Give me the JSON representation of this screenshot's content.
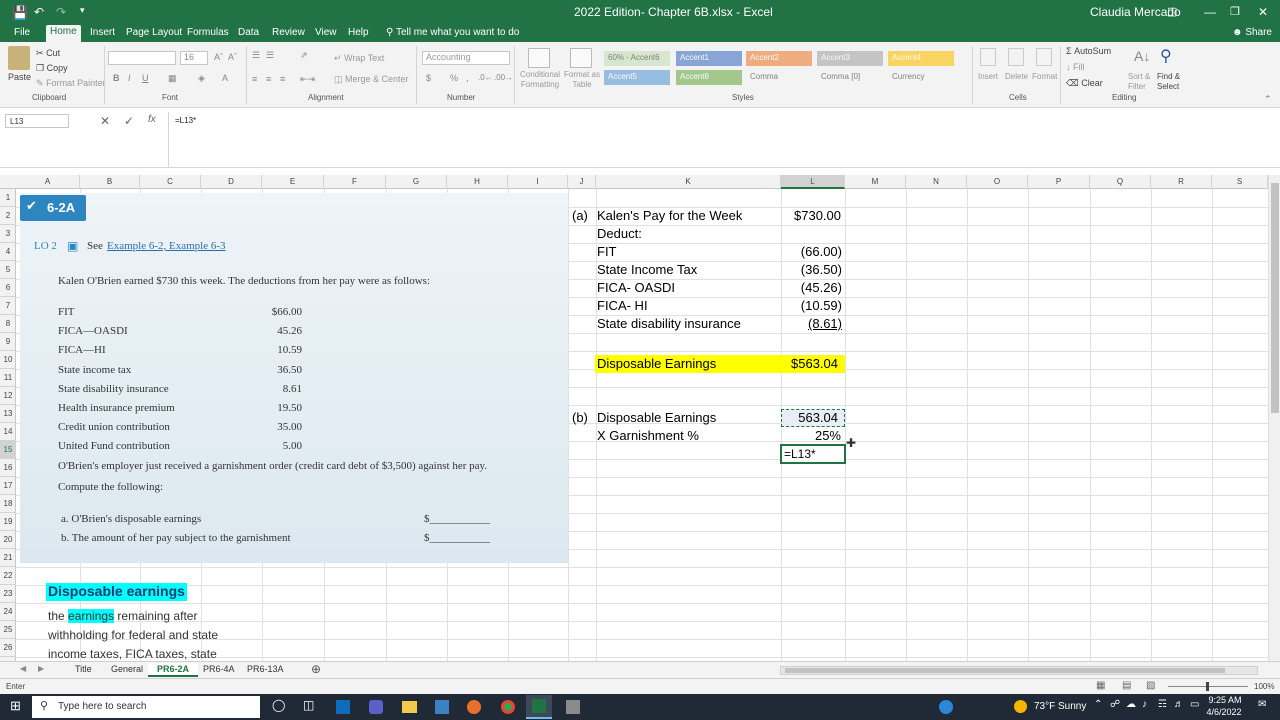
{
  "titlebar": {
    "doc_title": "2022 Edition- Chapter 6B.xlsx - Excel",
    "user": "Claudia Mercado"
  },
  "ribbon_tabs": [
    "File",
    "Home",
    "Insert",
    "Page Layout",
    "Formulas",
    "Data",
    "Review",
    "View",
    "Help"
  ],
  "tell_me": "Tell me what you want to do",
  "share_label": "Share",
  "ribbon": {
    "paste": "Paste",
    "cut": "Cut",
    "copy": "Copy",
    "format_painter": "Format Painter",
    "font_size": "16",
    "wrap_text": "Wrap Text",
    "merge_center": "Merge & Center",
    "number_format": "Accounting",
    "conditional_formatting": "Conditional Formatting",
    "format_as_table": "Format as Table",
    "insert": "Insert",
    "delete": "Delete",
    "format": "Format",
    "autosum": "AutoSum",
    "fill": "Fill",
    "clear": "Clear",
    "sort_filter": "Sort & Filter",
    "find_select": "Find & Select",
    "groups": [
      "Clipboard",
      "Font",
      "Alignment",
      "Number",
      "Styles",
      "Cells",
      "Editing"
    ]
  },
  "styles_gallery": [
    {
      "label": "60% - Accent6",
      "bg": "#c6e0b4",
      "fg": "#333333"
    },
    {
      "label": "Accent1",
      "bg": "#4472c4",
      "fg": "#ffffff"
    },
    {
      "label": "Accent2",
      "bg": "#ed7d31",
      "fg": "#ffffff"
    },
    {
      "label": "Accent3",
      "bg": "#a5a5a5",
      "fg": "#ffffff"
    },
    {
      "label": "Accent4",
      "bg": "#ffc000",
      "fg": "#ffffff"
    },
    {
      "label": "Accent5",
      "bg": "#5b9bd5",
      "fg": "#ffffff"
    },
    {
      "label": "Accent6",
      "bg": "#70ad47",
      "fg": "#ffffff"
    },
    {
      "label": "Comma",
      "bg": "#f3f3f3",
      "fg": "#333333"
    },
    {
      "label": "Comma [0]",
      "bg": "#f3f3f3",
      "fg": "#333333"
    },
    {
      "label": "Currency",
      "bg": "#f3f3f3",
      "fg": "#333333"
    }
  ],
  "formula_bar": {
    "name_box": "L13",
    "formula": "=L13*"
  },
  "columns": [
    "A",
    "B",
    "C",
    "D",
    "E",
    "F",
    "G",
    "H",
    "I",
    "J",
    "K",
    "L",
    "M",
    "N",
    "O",
    "P",
    "Q",
    "R",
    "S"
  ],
  "rows": [
    "1",
    "2",
    "3",
    "4",
    "5",
    "6",
    "7",
    "8",
    "9",
    "10",
    "11",
    "12",
    "13",
    "14",
    "15",
    "16",
    "17",
    "18",
    "19",
    "20",
    "21",
    "22",
    "23",
    "24",
    "25",
    "26"
  ],
  "textbook": {
    "badge": "6-2A",
    "lo": "LO 2",
    "see": "See",
    "example_links": "Example 6-2, Example 6-3",
    "intro": "Kalen O'Brien earned $730 this week. The deductions from her pay were as follows:",
    "deductions": [
      {
        "label": "FIT",
        "amount": "$66.00"
      },
      {
        "label": "FICA—OASDI",
        "amount": "45.26"
      },
      {
        "label": "FICA—HI",
        "amount": "10.59"
      },
      {
        "label": "State income tax",
        "amount": "36.50"
      },
      {
        "label": "State disability insurance",
        "amount": "8.61"
      },
      {
        "label": "Health insurance premium",
        "amount": "19.50"
      },
      {
        "label": "Credit union contribution",
        "amount": "35.00"
      },
      {
        "label": "United Fund contribution",
        "amount": "5.00"
      }
    ],
    "garnishment": "O'Brien's employer just received a garnishment order (credit card debt of $3,500) against her pay.",
    "compute": "Compute the following:",
    "q_a": "a.  O'Brien's disposable earnings",
    "q_b": "b.  The amount of her pay subject to the garnishment",
    "blank": "$___________"
  },
  "definition": {
    "title_1": "Disposable",
    "title_2": "earnings",
    "line1_pre": "the",
    "line1_hl": "earnings",
    "line1_post": "remaining after",
    "line2": "withholding for federal and state",
    "line3": "income taxes, FICA taxes, state"
  },
  "worksheet": {
    "part_a": "(a)",
    "pay_label": "Kalen's Pay for the Week",
    "pay_value": "$730.00",
    "deduct": "Deduct:",
    "lines": [
      {
        "label": "FIT",
        "value": "(66.00)"
      },
      {
        "label": "State Income Tax",
        "value": "(36.50)"
      },
      {
        "label": "FICA- OASDI",
        "value": "(45.26)"
      },
      {
        "label": "FICA- HI",
        "value": "(10.59)"
      },
      {
        "label": "State disability insurance",
        "value": "(8.61)"
      }
    ],
    "disp_label": "Disposable Earnings",
    "disp_value": "$563.04",
    "part_b": "(b)",
    "b_disp_label": "Disposable Earnings",
    "b_disp_value": "563.04",
    "garn_label": "X Garnishment %",
    "garn_value": "25%",
    "editing_value": "=L13*"
  },
  "sheet_tabs": [
    "Title",
    "General",
    "PR6-2A",
    "PR6-4A",
    "PR6-13A"
  ],
  "active_sheet": "PR6-2A",
  "status_mode": "Enter",
  "zoom": "100%",
  "taskbar": {
    "search": "Type here to search",
    "weather": "73°F  Sunny",
    "time": "9:25 AM",
    "date": "4/6/2022"
  },
  "colors": {
    "excel_green": "#217346",
    "highlight_yellow": "#ffff00",
    "highlight_cyan": "#00ffff",
    "badge_blue": "#2e86c1"
  }
}
